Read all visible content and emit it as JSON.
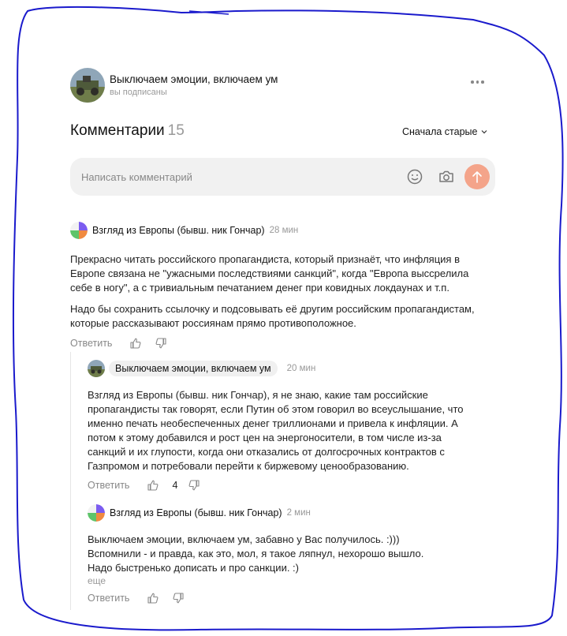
{
  "channel": {
    "name": "Выключаем эмоции, включаем ум",
    "subscribed": "вы подписаны"
  },
  "comments_header": {
    "title": "Комментарии",
    "count": "15",
    "sort_label": "Сначала старые"
  },
  "input": {
    "placeholder": "Написать комментарий"
  },
  "comments": [
    {
      "author": "Взгляд из Европы (бывш. ник Гончар)",
      "time": "28 мин",
      "paragraphs": [
        "Прекрасно читать российского пропагандиста, который признаёт, что инфляция в Европе связана не \"ужасными последствиями санкций\", когда \"Европа выссрелила себе в ногу\", а с тривиальным печатанием денег при ковидных локдаунах и т.п.",
        "Надо бы сохранить ссылочку и подсовывать её другим российским пропагандистам, которые рассказывают россиянам прямо противоположное."
      ],
      "reply_label": "Ответить"
    },
    {
      "author": "Выключаем эмоции, включаем ум",
      "time": "20 мин",
      "paragraphs": [
        "Взгляд из Европы (бывш. ник Гончар), я не знаю, какие там российские пропагандисты так говорят, если Путин об этом говорил во всеуслышание, что именно печать необеспеченных денег триллионами и привела к инфляции. А потом к этому добавился и рост цен на энергоносители, в том числе из-за санкций и их глупости, когда они отказались от долгосрочных контрактов с Газпромом и потребовали перейти к биржевому ценообразованию."
      ],
      "reply_label": "Ответить",
      "likes": "4"
    },
    {
      "author": "Взгляд из Европы (бывш. ник Гончар)",
      "time": "2 мин",
      "paragraphs": [
        "Выключаем эмоции, включаем ум, забавно у Вас получилось. :)))",
        "Вспомнили - и правда, как это, мол, я такое ляпнул, нехорошо вышло.",
        "Надо быстренько дописать и про санкции. :)"
      ],
      "more_label": "еще",
      "reply_label": "Ответить"
    }
  ],
  "icons": {
    "more": "more-dots-icon",
    "sort": "chevron-down-icon",
    "emoji": "smile-icon",
    "camera": "camera-icon",
    "send": "arrow-up-icon",
    "like": "thumbs-up-icon",
    "dislike": "thumbs-down-icon"
  },
  "colors": {
    "send_button": "#f4a48a",
    "input_background": "#f1f1f1",
    "hand_drawn_border": "#1a1acc"
  }
}
